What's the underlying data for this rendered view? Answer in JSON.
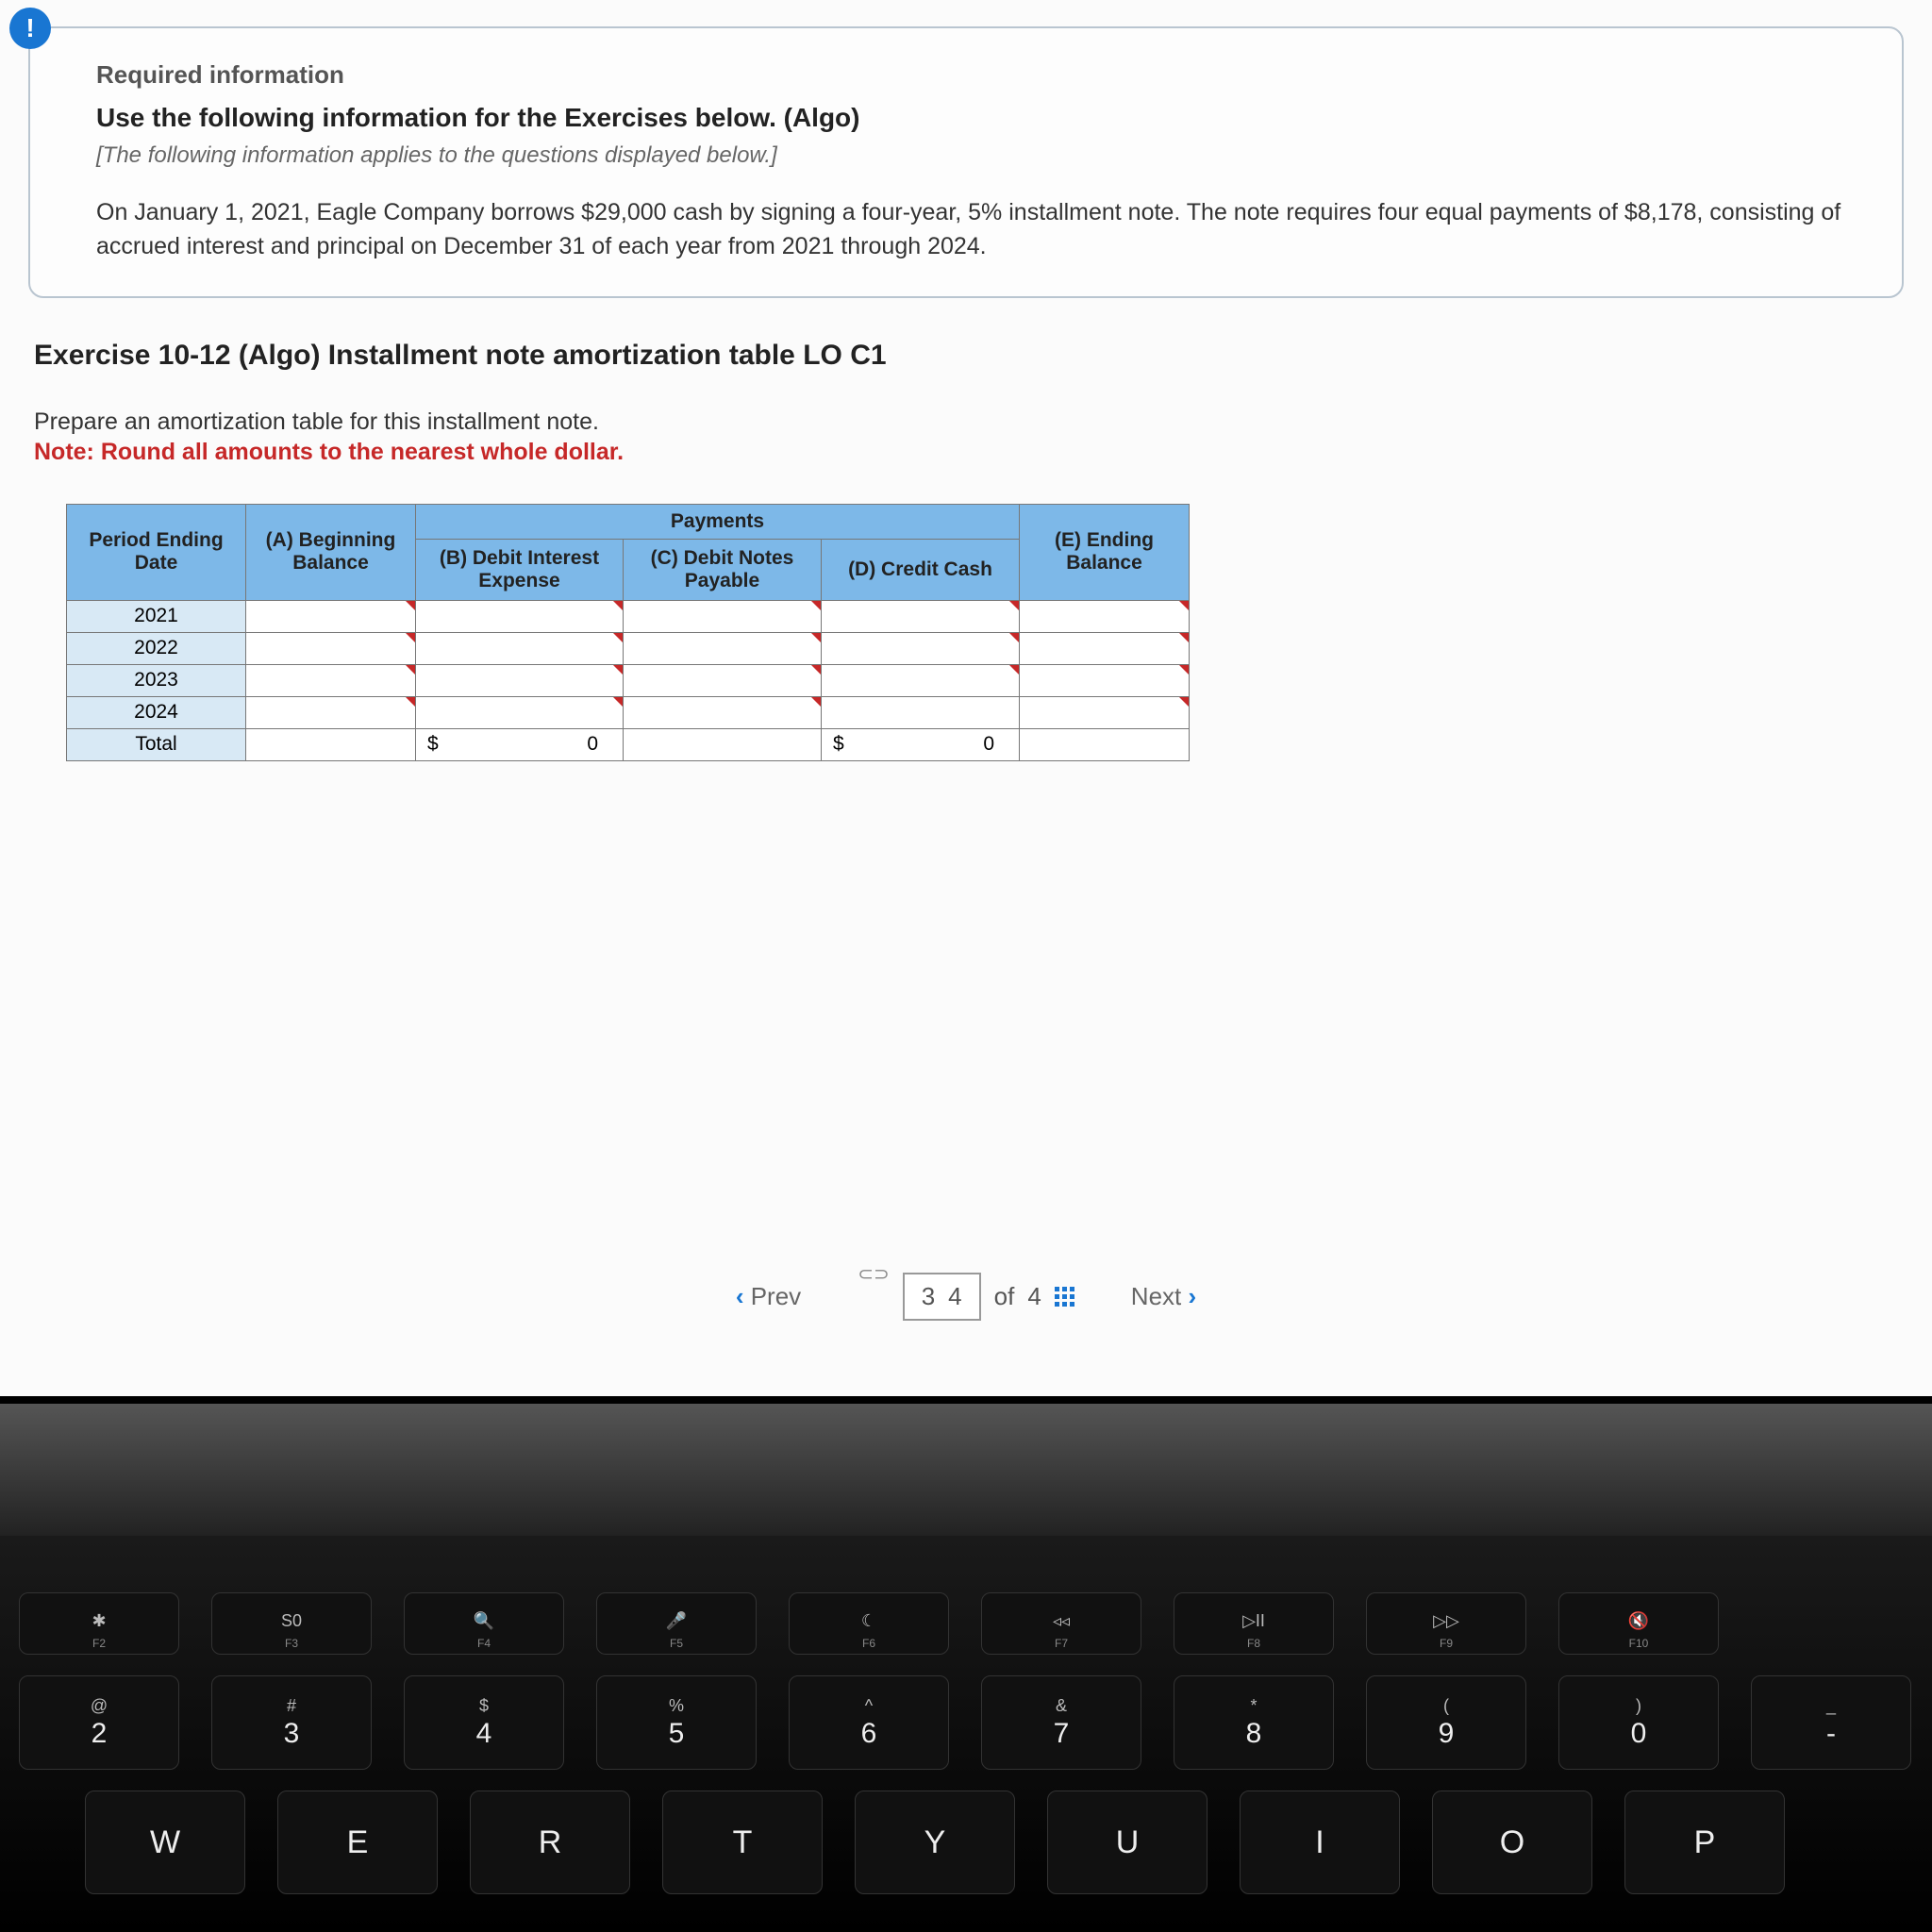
{
  "info": {
    "heading": "Required information",
    "subheading": "Use the following information for the Exercises below. (Algo)",
    "italic": "[The following information applies to the questions displayed below.]",
    "body": "On January 1, 2021, Eagle Company borrows $29,000 cash by signing a four-year, 5% installment note. The note requires four equal payments of $8,178, consisting of accrued interest and principal on December 31 of each year from 2021 through 2024."
  },
  "exercise": {
    "title": "Exercise 10-12 (Algo) Installment note amortization table LO C1",
    "instruction": "Prepare an amortization table for this installment note.",
    "note": "Note: Round all amounts to the nearest whole dollar."
  },
  "table": {
    "payments_group": "Payments",
    "headers": {
      "date": "Period Ending Date",
      "beg": "(A) Beginning Balance",
      "int": "(B) Debit Interest Expense",
      "notes": "(C) Debit Notes Payable",
      "cash": "(D) Credit Cash",
      "end": "(E) Ending Balance"
    },
    "rows": [
      "2021",
      "2022",
      "2023",
      "2024"
    ],
    "total_label": "Total",
    "total_int_cur": "$",
    "total_int_val": "0",
    "total_cash_cur": "$",
    "total_cash_val": "0"
  },
  "pager": {
    "prev": "Prev",
    "next": "Next",
    "current": "3",
    "total_shown": "4",
    "of": "of",
    "count": "4"
  },
  "keyboard": {
    "fn_row": [
      {
        "icon": "✱",
        "fn": "F2"
      },
      {
        "icon": "S0",
        "fn": "F3"
      },
      {
        "icon": "🔍",
        "fn": "F4"
      },
      {
        "icon": "🎤",
        "fn": "F5"
      },
      {
        "icon": "☾",
        "fn": "F6"
      },
      {
        "icon": "◃◃",
        "fn": "F7"
      },
      {
        "icon": "▷II",
        "fn": "F8"
      },
      {
        "icon": "▷▷",
        "fn": "F9"
      },
      {
        "icon": "🔇",
        "fn": "F10"
      }
    ],
    "num_row": [
      {
        "top": "@",
        "bot": "2"
      },
      {
        "top": "#",
        "bot": "3"
      },
      {
        "top": "$",
        "bot": "4"
      },
      {
        "top": "%",
        "bot": "5"
      },
      {
        "top": "^",
        "bot": "6"
      },
      {
        "top": "&",
        "bot": "7"
      },
      {
        "top": "*",
        "bot": "8"
      },
      {
        "top": "(",
        "bot": "9"
      },
      {
        "top": ")",
        "bot": "0"
      },
      {
        "top": "_",
        "bot": "-"
      }
    ],
    "letter_row": [
      "W",
      "E",
      "R",
      "T",
      "Y",
      "U",
      "I",
      "O",
      "P"
    ]
  }
}
